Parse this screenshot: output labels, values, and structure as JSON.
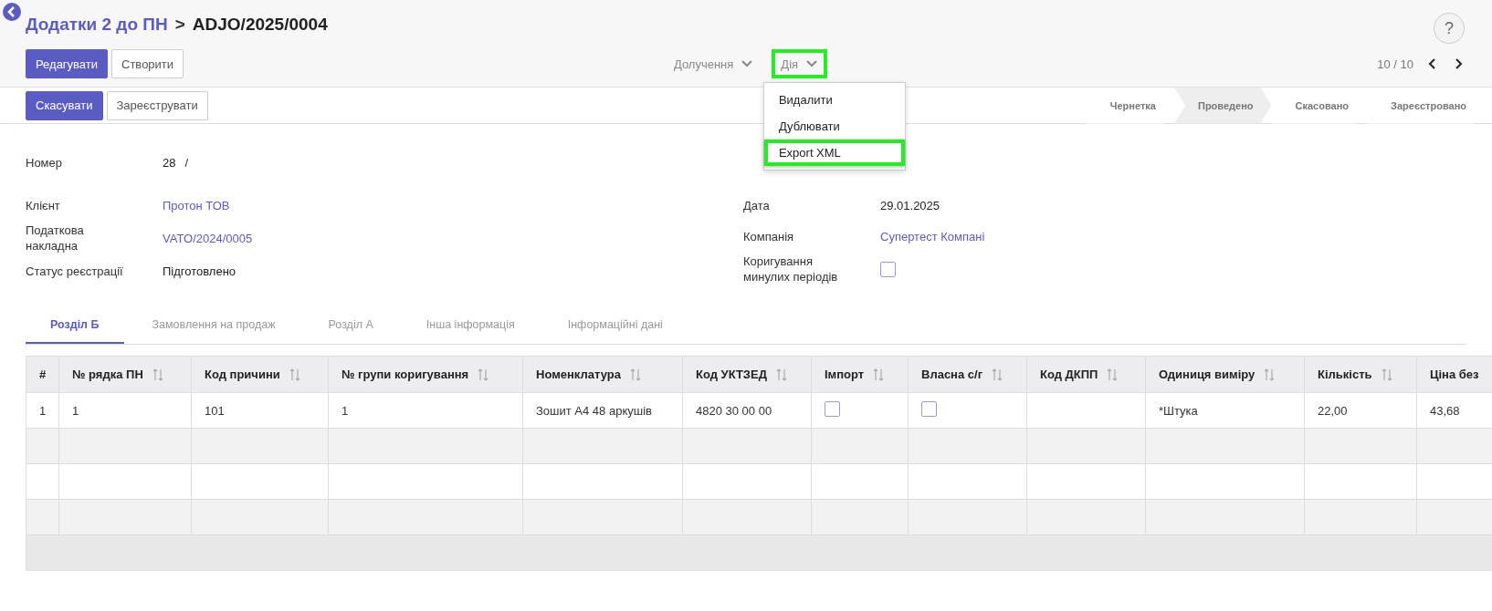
{
  "breadcrumb": {
    "parent": "Додатки 2 до ПН",
    "separator": ">",
    "current": "ADJO/2025/0004"
  },
  "help_button": "?",
  "toolbar": {
    "buttons": [
      {
        "label": "Редагувати",
        "primary": true
      },
      {
        "label": "Створити",
        "primary": false
      }
    ],
    "menus": [
      {
        "label": "Долучення",
        "highlighted": false
      },
      {
        "label": "Дія",
        "highlighted": true
      }
    ],
    "action_menu": [
      {
        "label": "Видалити",
        "highlighted": false
      },
      {
        "label": "Дублювати",
        "highlighted": false
      },
      {
        "label": "Export XML",
        "highlighted": true
      }
    ],
    "pager": "10 / 10"
  },
  "status_bar": {
    "buttons": [
      {
        "label": "Скасувати",
        "primary": true
      },
      {
        "label": "Зареєструвати",
        "primary": false
      }
    ],
    "stages": [
      {
        "label": "Чернетка",
        "selected": false
      },
      {
        "label": "Проведено",
        "selected": true
      },
      {
        "label": "Скасовано",
        "selected": false
      },
      {
        "label": "Зареєстровано",
        "selected": false
      }
    ]
  },
  "form": {
    "number_label": "Номер",
    "number_value": "28",
    "number_suffix": "/",
    "left_fields": [
      {
        "label": "Клієнт",
        "value": "Протон ТОВ",
        "link": true
      },
      {
        "label": "Податкова накладна",
        "value": "VATO/2024/0005",
        "link": true
      },
      {
        "label": "Статус реєстрації",
        "value": "Підготовлено",
        "link": false
      }
    ],
    "right_fields": [
      {
        "label": "Дата",
        "kind": "text",
        "value": "29.01.2025",
        "link": false
      },
      {
        "label": "Компанія",
        "kind": "text",
        "value": "Супертест Компані",
        "link": true
      },
      {
        "label": "Коригування минулих періодів",
        "kind": "checkbox",
        "checked": false
      }
    ]
  },
  "tabs": [
    {
      "label": "Розділ Б",
      "selected": true
    },
    {
      "label": "Замовлення на продаж",
      "selected": false
    },
    {
      "label": "Розділ А",
      "selected": false
    },
    {
      "label": "Інша інформація",
      "selected": false
    },
    {
      "label": "Інформаційні дані",
      "selected": false
    }
  ],
  "table": {
    "columns": [
      {
        "label": "#",
        "sortable": false
      },
      {
        "label": "№ рядка ПН",
        "sortable": true
      },
      {
        "label": "Код причини",
        "sortable": true
      },
      {
        "label": "№ групи коригування",
        "sortable": true
      },
      {
        "label": "Номенклатура",
        "sortable": true
      },
      {
        "label": "Код УКТЗЕД",
        "sortable": true
      },
      {
        "label": "Імпорт",
        "sortable": true
      },
      {
        "label": "Власна с/г",
        "sortable": true
      },
      {
        "label": "Код ДКПП",
        "sortable": true
      },
      {
        "label": "Одиниця виміру",
        "sortable": true
      },
      {
        "label": "Кількість",
        "sortable": true
      },
      {
        "label": "Ціна без",
        "sortable": false
      }
    ],
    "rows": [
      {
        "cells": [
          {
            "kind": "text",
            "value": "1"
          },
          {
            "kind": "text",
            "value": "1"
          },
          {
            "kind": "text",
            "value": "101"
          },
          {
            "kind": "text",
            "value": "1"
          },
          {
            "kind": "text",
            "value": "Зошит А4 48 аркушів"
          },
          {
            "kind": "text",
            "value": "4820 30 00 00"
          },
          {
            "kind": "checkbox",
            "checked": false
          },
          {
            "kind": "checkbox",
            "checked": false
          },
          {
            "kind": "empty"
          },
          {
            "kind": "text",
            "value": "*Штука"
          },
          {
            "kind": "text",
            "value": "22,00"
          },
          {
            "kind": "text",
            "value": "43,68"
          }
        ]
      }
    ]
  }
}
